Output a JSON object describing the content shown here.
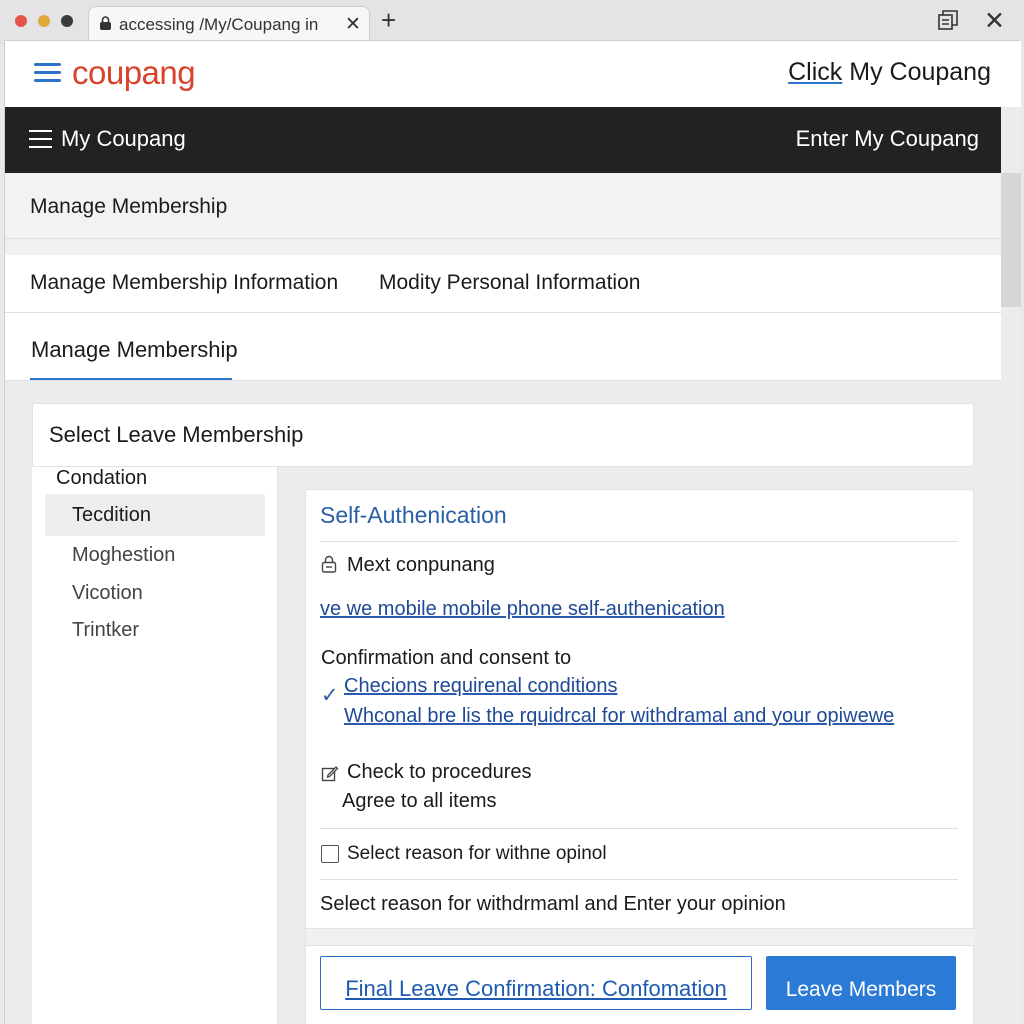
{
  "browser": {
    "tab_title": "accessing /My/Coupang in",
    "tab_close": "✕",
    "new_tab": "+",
    "window_close": "✕"
  },
  "header": {
    "logo": "coupang",
    "cta_link": "Click",
    "cta_rest": " My Coupang"
  },
  "navbar": {
    "title": "My Coupang",
    "right": "Enter My Coupang"
  },
  "section_bar": {
    "label": "Manage Membership"
  },
  "subtabs": [
    {
      "label": "Manage Membership Information"
    },
    {
      "label": "Modity Personal Information"
    }
  ],
  "active_tab": {
    "label": "Manage Membership"
  },
  "leave_card": {
    "label": "Select Leave Membership"
  },
  "left_panel": {
    "heading": "Condation",
    "items": [
      {
        "label": "Tecdition"
      },
      {
        "label": "Moghestion"
      },
      {
        "label": "Vicotion"
      },
      {
        "label": "Trintker"
      }
    ]
  },
  "main": {
    "title": "Self-Authenication",
    "lock_label": "Mext conpunang",
    "auth_link": "ve we mobile mobile phone self-authenication",
    "consent_heading": "Confirmation and consent to",
    "conditions_link": "Checions requirenal conditions",
    "withdrawal_link": "Whconal bre lis the rquidrcal for withdramal and your opiwewe",
    "procedures": "Check to procedures",
    "agree_all": "Agree to all items",
    "select_reason_checkbox": "Select reason for withпe opinol",
    "select_reason_text": "Select reason for withdrmaml and  Enter your opinion",
    "final_button": "Final Leave Confirmation: Confomation",
    "leave_button": "Leave Members",
    "check_glyph": "✓"
  },
  "colors": {
    "accent": "#2b7bd6",
    "logo": "#d8432d",
    "navbar": "#222222",
    "link": "#1f4a96"
  },
  "icons": [
    "lock-icon",
    "hamburger-icon",
    "check-icon",
    "edit-icon",
    "checkbox-icon",
    "window-restore-icon",
    "close-icon",
    "plus-icon"
  ]
}
